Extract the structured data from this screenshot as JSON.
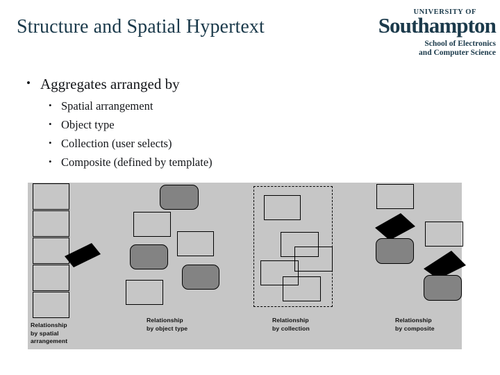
{
  "slide": {
    "title": "Structure and Spatial Hypertext",
    "title_color": "#1b3a4b",
    "background_color": "#ffffff"
  },
  "logo": {
    "university_line": "UNIVERSITY OF",
    "name": "Southampton",
    "school_line1": "School of Electronics",
    "school_line2": "and Computer Science",
    "color": "#1b3a4b"
  },
  "content": {
    "main_bullet": "Aggregates arranged by",
    "sub_bullets": [
      "Spatial arrangement",
      "Object type",
      "Collection (user selects)",
      "Composite (defined by template)"
    ]
  },
  "diagram": {
    "background_color": "#c6c6c6",
    "panels": [
      {
        "id": "spatial-arrangement",
        "caption": "Relationship\nby spatial\narrangement",
        "description": "Five identical light rectangles stacked in a vertical column with a black rotated rectangle overlapping at the middle right"
      },
      {
        "id": "object-type",
        "caption": "Relationship\nby object type",
        "description": "Three light square-cornered rectangles and three dark gray rounded rectangles interleaved"
      },
      {
        "id": "collection",
        "caption": "Relationship\nby collection",
        "description": "Five overlapping outline rectangles enclosed by a dashed selection boundary"
      },
      {
        "id": "composite",
        "caption": "Relationship\nby composite",
        "description": "Two light rectangles, two black rotated rectangles and two dark gray rounded rectangles"
      }
    ],
    "shape_colors": {
      "light_fill": "#c6c6c6",
      "gray_fill": "#838383",
      "black_fill": "#000000",
      "outline": "#000000"
    }
  }
}
